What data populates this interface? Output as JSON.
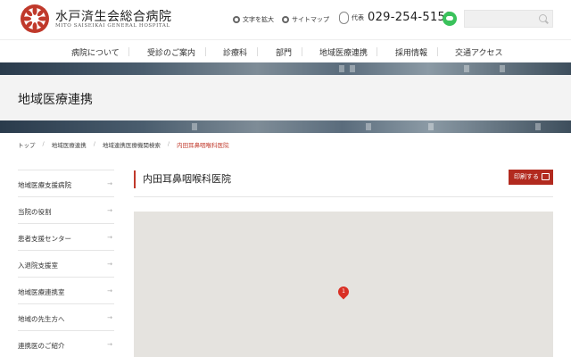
{
  "header": {
    "hospital_name": "水戸済生会総合病院",
    "hospital_name_en": "MITO SAISEIKAI GENERAL HOSPITAL",
    "utility_links": [
      {
        "label": "文字を拡大",
        "icon": "text-size-icon"
      },
      {
        "label": "サイトマップ",
        "icon": "sitemap-icon"
      }
    ],
    "phone_label": "代表",
    "phone_number": "029-254-5151",
    "search_placeholder": ""
  },
  "nav": {
    "items": [
      "病院について",
      "受診のご案内",
      "診療科",
      "部門",
      "地域医療連携",
      "採用情報",
      "交通アクセス"
    ]
  },
  "page": {
    "heading": "地域医療連携"
  },
  "breadcrumb": [
    "トップ",
    "地域医療連携",
    "地域連携医療機関検索",
    "内田耳鼻咽喉科医院"
  ],
  "sidebar": {
    "items": [
      "地域医療支援病院",
      "当院の役割",
      "患者支援センター",
      "入退院支援室",
      "地域医療連携室",
      "地域の先生方へ",
      "連携医のご紹介"
    ]
  },
  "main": {
    "title": "内田耳鼻咽喉科医院",
    "print_label": "印刷する",
    "map_marker": "1"
  },
  "colors": {
    "accent": "#b22a1f",
    "map_bg": "#e5e3df",
    "line_green": "#3ac25b"
  }
}
